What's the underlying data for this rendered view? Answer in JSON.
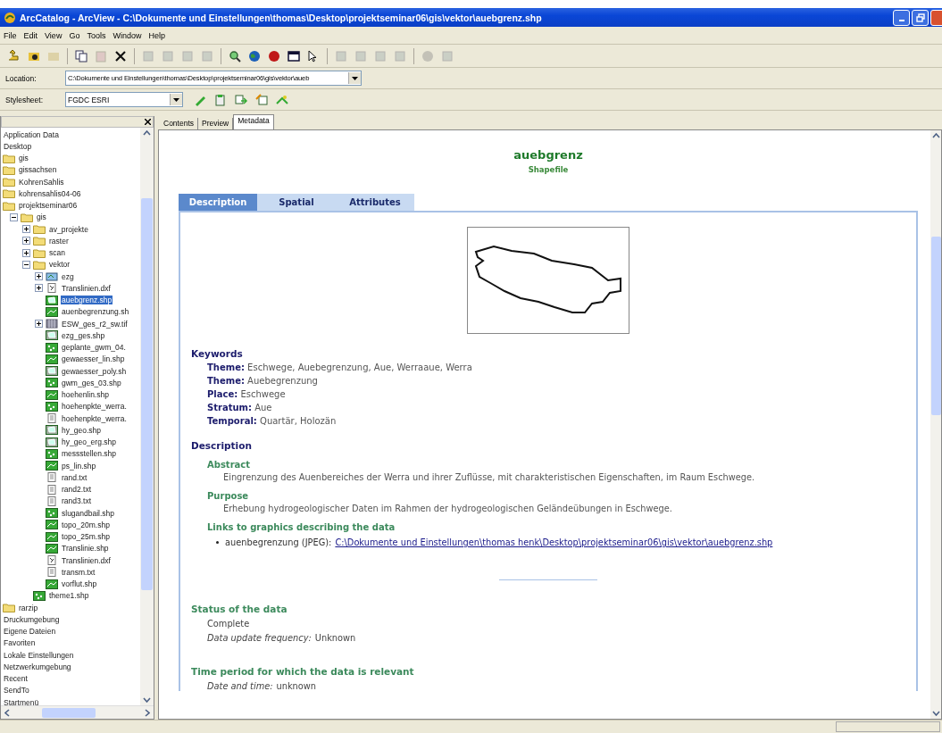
{
  "window": {
    "title": "ArcCatalog - ArcView - C:\\Dokumente und Einstellungen\\thomas\\Desktop\\projektseminar06\\gis\\vektor\\auebgrenz.shp"
  },
  "menu": [
    "File",
    "Edit",
    "View",
    "Go",
    "Tools",
    "Window",
    "Help"
  ],
  "toolbar": [
    {
      "kind": "up",
      "disabled": false
    },
    {
      "kind": "connect",
      "disabled": false
    },
    {
      "kind": "disconnect",
      "disabled": true
    },
    {
      "kind": "sep"
    },
    {
      "kind": "copy",
      "disabled": false
    },
    {
      "kind": "paste",
      "disabled": true
    },
    {
      "kind": "delete",
      "disabled": false
    },
    {
      "kind": "sep"
    },
    {
      "kind": "largeicons",
      "disabled": true
    },
    {
      "kind": "list",
      "disabled": true
    },
    {
      "kind": "details",
      "disabled": true
    },
    {
      "kind": "thumbnails",
      "disabled": true
    },
    {
      "kind": "sep"
    },
    {
      "kind": "search",
      "disabled": false
    },
    {
      "kind": "globe",
      "disabled": false
    },
    {
      "kind": "toolbox",
      "disabled": false
    },
    {
      "kind": "window",
      "disabled": false
    },
    {
      "kind": "help",
      "disabled": false
    },
    {
      "kind": "sep"
    },
    {
      "kind": "zoomin",
      "disabled": true
    },
    {
      "kind": "zoomout",
      "disabled": true
    },
    {
      "kind": "pan",
      "disabled": true
    },
    {
      "kind": "full",
      "disabled": true
    },
    {
      "kind": "sep"
    },
    {
      "kind": "identify",
      "disabled": true
    },
    {
      "kind": "thumb",
      "disabled": true
    }
  ],
  "location": {
    "label": "Location:",
    "value": "C:\\Dokumente und Einstellungen\\thomas\\Desktop\\projektseminar06\\gis\\vektor\\aueb"
  },
  "stylesheet": {
    "label": "Stylesheet:",
    "value": "FGDC ESRI"
  },
  "catalog_tree": {
    "items": [
      {
        "label": "Application Data",
        "kind": "none",
        "selected": false
      },
      {
        "label": "Desktop",
        "kind": "none",
        "selected": false
      },
      {
        "label": "gis",
        "kind": "folder",
        "selected": false
      },
      {
        "label": "gissachsen",
        "kind": "folder",
        "selected": false
      },
      {
        "label": "KohrenSahlis",
        "kind": "folder",
        "selected": false
      },
      {
        "label": "kohrensahlis04-06",
        "kind": "folder",
        "selected": false
      },
      {
        "label": "projektseminar06",
        "kind": "folder",
        "selected": false,
        "children": [
          {
            "label": "gis",
            "kind": "folder",
            "selected": false,
            "expanded": true,
            "children": [
              {
                "label": "av_projekte",
                "kind": "folder",
                "selected": false,
                "expanded": false
              },
              {
                "label": "raster",
                "kind": "folder",
                "selected": false,
                "expanded": false
              },
              {
                "label": "scan",
                "kind": "folder",
                "selected": false,
                "expanded": false
              },
              {
                "label": "vektor",
                "kind": "folder",
                "selected": false,
                "expanded": true,
                "children": [
                  {
                    "label": "ezg",
                    "kind": "layer",
                    "selected": false,
                    "expanded": false
                  },
                  {
                    "label": "Translinien.dxf",
                    "kind": "cad",
                    "selected": false,
                    "expanded": false
                  },
                  {
                    "label": "auebgrenz.shp",
                    "kind": "polygon",
                    "selected": true
                  },
                  {
                    "label": "auenbegrenzung.sh",
                    "kind": "line",
                    "selected": false
                  },
                  {
                    "label": "ESW_ges_r2_sw.tif",
                    "kind": "raster",
                    "selected": false,
                    "expanded": false
                  },
                  {
                    "label": "ezg_ges.shp",
                    "kind": "polygon-grey",
                    "selected": false
                  },
                  {
                    "label": "geplante_gwm_04.",
                    "kind": "point",
                    "selected": false
                  },
                  {
                    "label": "gewaesser_lin.shp",
                    "kind": "line",
                    "selected": false
                  },
                  {
                    "label": "gewaesser_poly.sh",
                    "kind": "polygon-grey",
                    "selected": false
                  },
                  {
                    "label": "gwm_ges_03.shp",
                    "kind": "point",
                    "selected": false
                  },
                  {
                    "label": "hoehenlin.shp",
                    "kind": "line",
                    "selected": false
                  },
                  {
                    "label": "hoehenpkte_werra.",
                    "kind": "point",
                    "selected": false
                  },
                  {
                    "label": "hoehenpkte_werra.",
                    "kind": "table",
                    "selected": false
                  },
                  {
                    "label": "hy_geo.shp",
                    "kind": "polygon-grey",
                    "selected": false
                  },
                  {
                    "label": "hy_geo_erg.shp",
                    "kind": "polygon-grey",
                    "selected": false
                  },
                  {
                    "label": "messstellen.shp",
                    "kind": "point",
                    "selected": false
                  },
                  {
                    "label": "ps_lin.shp",
                    "kind": "line",
                    "selected": false
                  },
                  {
                    "label": "rand.txt",
                    "kind": "table",
                    "selected": false
                  },
                  {
                    "label": "rand2.txt",
                    "kind": "table",
                    "selected": false
                  },
                  {
                    "label": "rand3.txt",
                    "kind": "table",
                    "selected": false
                  },
                  {
                    "label": "slugandbail.shp",
                    "kind": "point",
                    "selected": false
                  },
                  {
                    "label": "topo_20m.shp",
                    "kind": "line",
                    "selected": false
                  },
                  {
                    "label": "topo_25m.shp",
                    "kind": "line",
                    "selected": false
                  },
                  {
                    "label": "Translinie.shp",
                    "kind": "line",
                    "selected": false
                  },
                  {
                    "label": "Translinien.dxf",
                    "kind": "cad",
                    "selected": false
                  },
                  {
                    "label": "transm.txt",
                    "kind": "table",
                    "selected": false
                  },
                  {
                    "label": "vorflut.shp",
                    "kind": "line",
                    "selected": false
                  }
                ]
              },
              {
                "label": "theme1.shp",
                "kind": "point",
                "selected": false
              }
            ]
          }
        ]
      },
      {
        "label": "rarzip",
        "kind": "folder",
        "selected": false
      },
      {
        "label": "Druckumgebung",
        "kind": "none",
        "selected": false
      },
      {
        "label": "Eigene Dateien",
        "kind": "none",
        "selected": false
      },
      {
        "label": "Favoriten",
        "kind": "none",
        "selected": false
      },
      {
        "label": "Lokale Einstellungen",
        "kind": "none",
        "selected": false
      },
      {
        "label": "Netzwerkumgebung",
        "kind": "none",
        "selected": false
      },
      {
        "label": "Recent",
        "kind": "none",
        "selected": false
      },
      {
        "label": "SendTo",
        "kind": "none",
        "selected": false
      },
      {
        "label": "Startmenü",
        "kind": "none",
        "selected": false
      }
    ]
  },
  "view_tabs": [
    {
      "label": "Contents",
      "selected": false
    },
    {
      "label": "Preview",
      "selected": false
    },
    {
      "label": "Metadata",
      "selected": true
    }
  ],
  "metadata": {
    "title": "auebgrenz",
    "subtitle": "Shapefile",
    "tabs": [
      {
        "label": "Description",
        "selected": true
      },
      {
        "label": "Spatial",
        "selected": false
      },
      {
        "label": "Attributes",
        "selected": false
      }
    ],
    "keywords": {
      "heading": "Keywords",
      "items": [
        {
          "label": "Theme:",
          "value": "Eschwege, Auebegrenzung, Aue, Werraaue, Werra"
        },
        {
          "label": "Theme:",
          "value": "Auebegrenzung"
        },
        {
          "label": "Place:",
          "value": "Eschwege"
        },
        {
          "label": "Stratum:",
          "value": "Aue"
        },
        {
          "label": "Temporal:",
          "value": "Quartär, Holozän"
        }
      ]
    },
    "description": {
      "heading": "Description",
      "sections": [
        {
          "heading": "Abstract",
          "text": "Eingrenzung des Auenbereiches der Werra und ihrer Zuflüsse, mit charakteristischen Eigenschaften,  im Raum Eschwege."
        },
        {
          "heading": "Purpose",
          "text": "Erhebung hydrogeologischer Daten im Rahmen der hydrogeologischen Geländeübungen in Eschwege."
        }
      ],
      "links": {
        "heading": "Links to graphics describing the data",
        "items": [
          {
            "label": "auenbegrenzung (JPEG):",
            "link": "C:\\Dokumente und Einstellungen\\thomas henk\\Desktop\\projektseminar06\\gis\\vektor\\auebgrenz.shp"
          }
        ]
      }
    },
    "status": {
      "heading": "Status of the data",
      "lines": [
        {
          "kind": "plain",
          "value": "Complete"
        },
        {
          "kind": "field",
          "label": "Data update frequency:",
          "value": "Unknown"
        }
      ]
    },
    "time_period": {
      "heading": "Time period for which the data is relevant",
      "lines": [
        {
          "kind": "field",
          "label": "Date and time:",
          "value": "unknown"
        }
      ]
    }
  }
}
